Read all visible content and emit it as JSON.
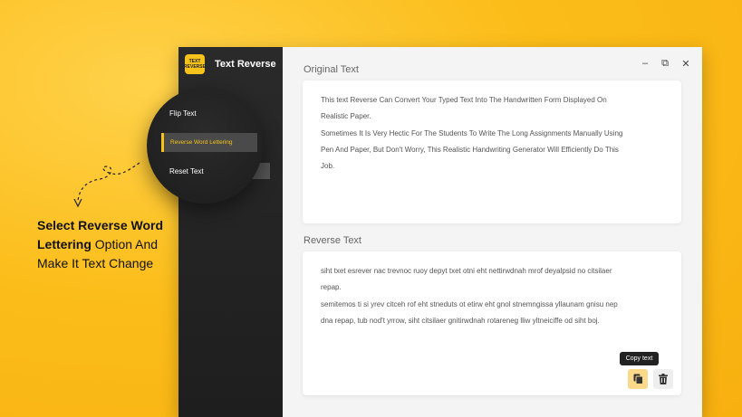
{
  "caption": {
    "bold_text": "Select Reverse Word Lettering",
    "rest_text": " Option And Make It Text Change"
  },
  "app": {
    "logo_line1": "TEXT",
    "logo_line2": "REVERSE",
    "title": "Text Reverse"
  },
  "menu": {
    "flip": "Flip Text",
    "reverse_word": "Reverse Word Lettering",
    "reset": "Reset Text"
  },
  "window_controls": {
    "minimize": "–",
    "restore": "⧉",
    "close": "✕"
  },
  "original": {
    "label": "Original Text",
    "lines": [
      "This text Reverse Can Convert Your Typed Text Into The Handwritten Form Displayed On",
      "Realistic Paper.",
      "Sometimes It Is Very Hectic For The Students To Write The Long Assignments Manually Using",
      "Pen And Paper, But Don't Worry, This Realistic Handwriting Generator Will Efficiently Do This",
      "Job."
    ]
  },
  "reversed": {
    "label": "Reverse Text",
    "lines": [
      "siht txet esrever nac trevnoc ruoy depyt txet otni eht nettirwdnah mrof deyalpsid no citsilaer",
      "repap.",
      "semitemos ti si yrev citceh rof eht stneduts ot etirw eht gnol stnemngissa yllaunam gnisu nep",
      "dna repap, tub nod't yrrow, siht citsilaer gnitirwdnah rotareneg lliw yltneiciffe od siht boj."
    ]
  },
  "tooltip": "Copy text",
  "icons": {
    "copy": "copy-icon",
    "delete": "trash-icon"
  },
  "colors": {
    "accent": "#f7c21a",
    "sidebar": "#222222",
    "copy_button_bg": "#fbd98a"
  }
}
